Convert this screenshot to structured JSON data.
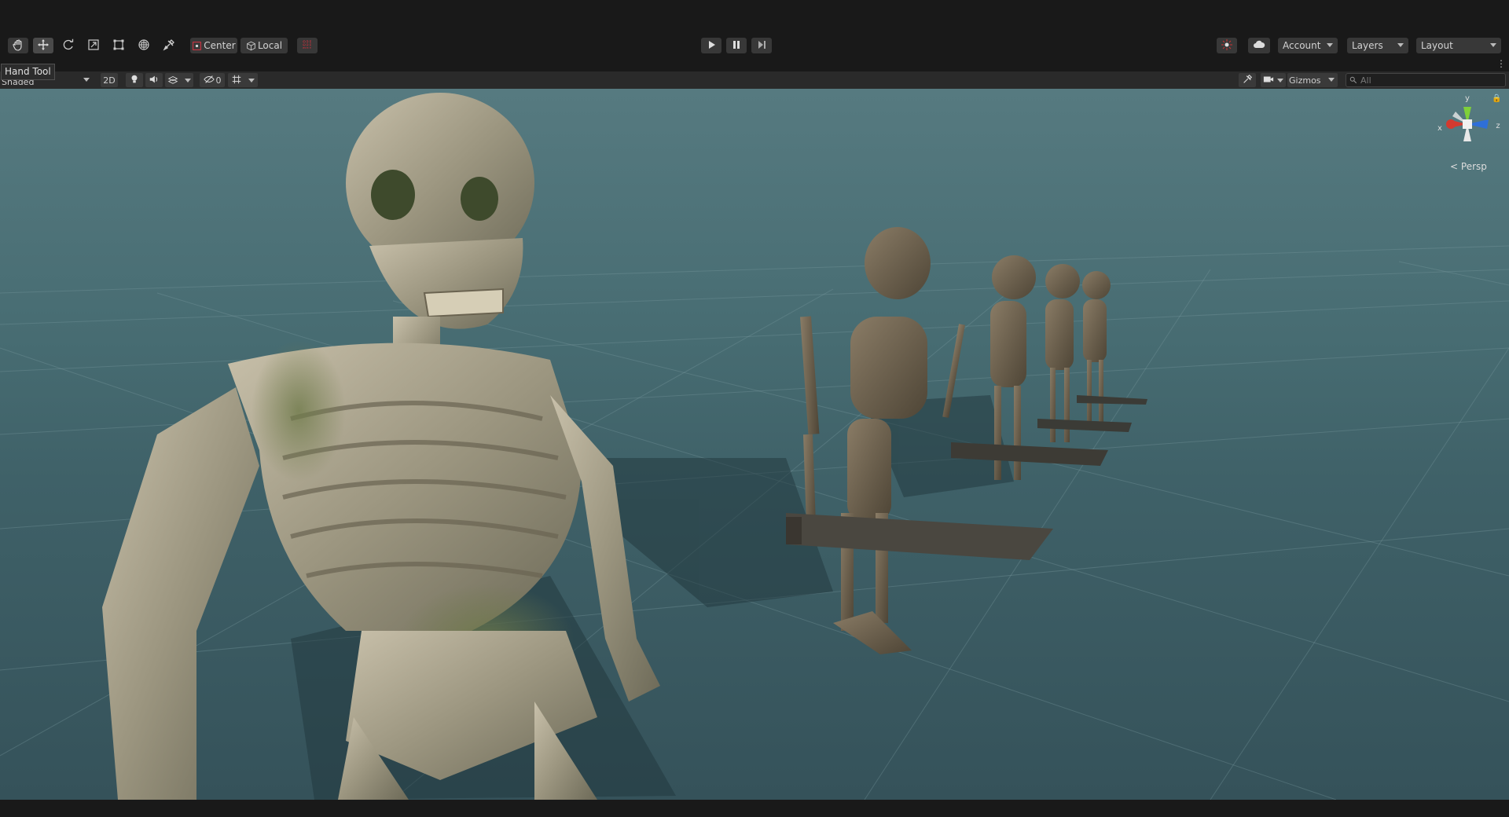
{
  "toolbar": {
    "tools": [
      {
        "name": "hand",
        "icon": "hand-icon"
      },
      {
        "name": "move",
        "icon": "move-icon"
      },
      {
        "name": "rotate",
        "icon": "rotate-icon"
      },
      {
        "name": "scale",
        "icon": "scale-icon"
      },
      {
        "name": "rect",
        "icon": "rect-tool-icon"
      },
      {
        "name": "transform",
        "icon": "transform-icon"
      },
      {
        "name": "custom",
        "icon": "custom-tool-icon"
      }
    ],
    "pivot_label": "Center",
    "space_label": "Local",
    "account_label": "Account",
    "layers_label": "Layers",
    "layout_label": "Layout"
  },
  "tooltip": {
    "text": "Hand Tool"
  },
  "scene_toolbar": {
    "draw_mode": "Shaded",
    "mode_2d": "2D",
    "hidden_count": "0",
    "gizmos_label": "Gizmos",
    "search_placeholder": "All"
  },
  "viewport": {
    "projection_label": "Persp",
    "axis_labels": {
      "x": "x",
      "y": "y",
      "z": "z"
    },
    "colors": {
      "sky_top": "#567a80",
      "ground": "#35525a",
      "x_axis": "#d33a2f",
      "y_axis": "#7fd03a",
      "z_axis": "#2f6fd8"
    }
  }
}
